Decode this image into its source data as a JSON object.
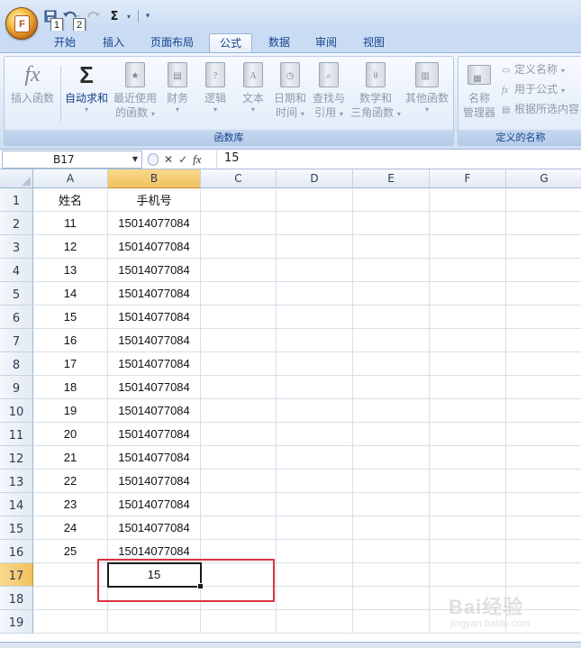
{
  "quick_access": {
    "office_button_letter": "F",
    "keytip_save": "1",
    "keytip_undo": "2",
    "sigma": "Σ"
  },
  "tabs": [
    {
      "label": "开始",
      "key": "home"
    },
    {
      "label": "插入",
      "key": "insert"
    },
    {
      "label": "页面布局",
      "key": "page-layout"
    },
    {
      "label": "公式",
      "key": "formulas",
      "active": true
    },
    {
      "label": "数据",
      "key": "data"
    },
    {
      "label": "审阅",
      "key": "review"
    },
    {
      "label": "视图",
      "key": "view"
    }
  ],
  "ribbon": {
    "function_library": {
      "label": "函数库",
      "insert_function": "插入函数",
      "autosum": "自动求和",
      "recent_line1": "最近使用",
      "recent_line2": "的函数",
      "financial": "财务",
      "logical": "逻辑",
      "text": "文本",
      "datetime_line1": "日期和",
      "datetime_line2": "时间",
      "lookup_line1": "查找与",
      "lookup_line2": "引用",
      "math_line1": "数学和",
      "math_line2": "三角函数",
      "more": "其他函数",
      "text_icon_glyph": "A",
      "logical_icon_glyph": "?",
      "math_icon_glyph": "θ",
      "fx_glyph": "fx",
      "sigma_glyph": "Σ"
    },
    "defined_names": {
      "label": "定义的名称",
      "name_manager_line1": "名称",
      "name_manager_line2": "管理器",
      "define_name": "定义名称",
      "use_in_formula": "用于公式",
      "create_from_selection": "根据所选内容"
    }
  },
  "formula_bar": {
    "name_box": "B17",
    "cancel": "✕",
    "enter": "✓",
    "fx": "fx",
    "value": "15"
  },
  "columns": [
    "A",
    "B",
    "C",
    "D",
    "E",
    "F",
    "G"
  ],
  "rows": [
    {
      "num": "1",
      "a": "姓名",
      "b": "手机号"
    },
    {
      "num": "2",
      "a": "11",
      "b": "15014077084"
    },
    {
      "num": "3",
      "a": "12",
      "b": "15014077084"
    },
    {
      "num": "4",
      "a": "13",
      "b": "15014077084"
    },
    {
      "num": "5",
      "a": "14",
      "b": "15014077084"
    },
    {
      "num": "6",
      "a": "15",
      "b": "15014077084"
    },
    {
      "num": "7",
      "a": "16",
      "b": "15014077084"
    },
    {
      "num": "8",
      "a": "17",
      "b": "15014077084"
    },
    {
      "num": "9",
      "a": "18",
      "b": "15014077084"
    },
    {
      "num": "10",
      "a": "19",
      "b": "15014077084"
    },
    {
      "num": "11",
      "a": "20",
      "b": "15014077084"
    },
    {
      "num": "12",
      "a": "21",
      "b": "15014077084"
    },
    {
      "num": "13",
      "a": "22",
      "b": "15014077084"
    },
    {
      "num": "14",
      "a": "23",
      "b": "15014077084"
    },
    {
      "num": "15",
      "a": "24",
      "b": "15014077084"
    },
    {
      "num": "16",
      "a": "25",
      "b": "15014077084"
    },
    {
      "num": "17",
      "a": "",
      "b": "15"
    },
    {
      "num": "18",
      "a": "",
      "b": ""
    },
    {
      "num": "19",
      "a": "",
      "b": ""
    }
  ],
  "selection": {
    "col": "B",
    "row": "17"
  },
  "watermark": {
    "text": "Bai经验",
    "sub": "jingyan.baidu.com"
  },
  "colors": {
    "accent": "#15428b",
    "highlight": "#d9343f",
    "selected_header": "#f1c15f"
  }
}
